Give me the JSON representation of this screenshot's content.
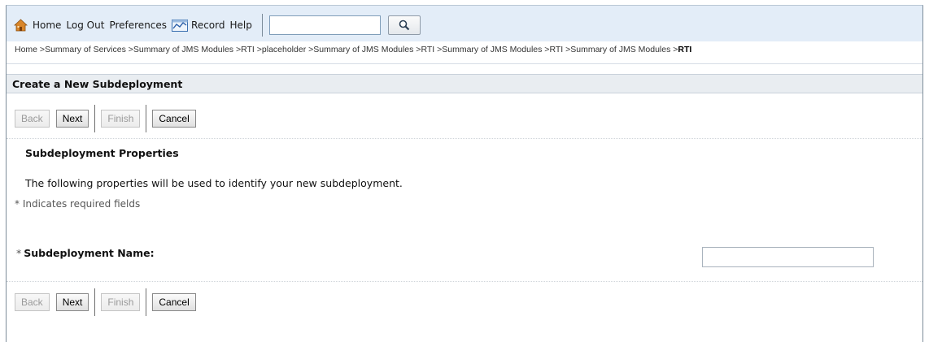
{
  "toolbar": {
    "items": [
      {
        "label": "Home",
        "icon": "home-icon"
      },
      {
        "label": "Log Out"
      },
      {
        "label": "Preferences"
      },
      {
        "label": "Record",
        "icon": "record-icon"
      },
      {
        "label": "Help"
      }
    ],
    "search_value": "",
    "search_icon": "magnifier-icon"
  },
  "breadcrumb": {
    "items": [
      "Home",
      "Summary of Services",
      "Summary of JMS Modules",
      "RTI",
      "placeholder",
      "Summary of JMS Modules",
      "RTI",
      "Summary of JMS Modules",
      "RTI",
      "Summary of JMS Modules"
    ],
    "separator": " >",
    "current": "RTI"
  },
  "page": {
    "title": "Create a New Subdeployment",
    "section_title": "Subdeployment Properties",
    "description": "The following properties will be used to identify your new subdeployment.",
    "required_note": "* Indicates required fields"
  },
  "buttons": {
    "back": "Back",
    "next": "Next",
    "finish": "Finish",
    "cancel": "Cancel"
  },
  "form": {
    "subdeployment_name": {
      "label": "Subdeployment Name:",
      "required_marker": "*",
      "value": ""
    }
  },
  "colors": {
    "toolbar_bg": "#e3edf8",
    "header_bg": "#e9edf1",
    "home_icon": "#d9862a"
  }
}
